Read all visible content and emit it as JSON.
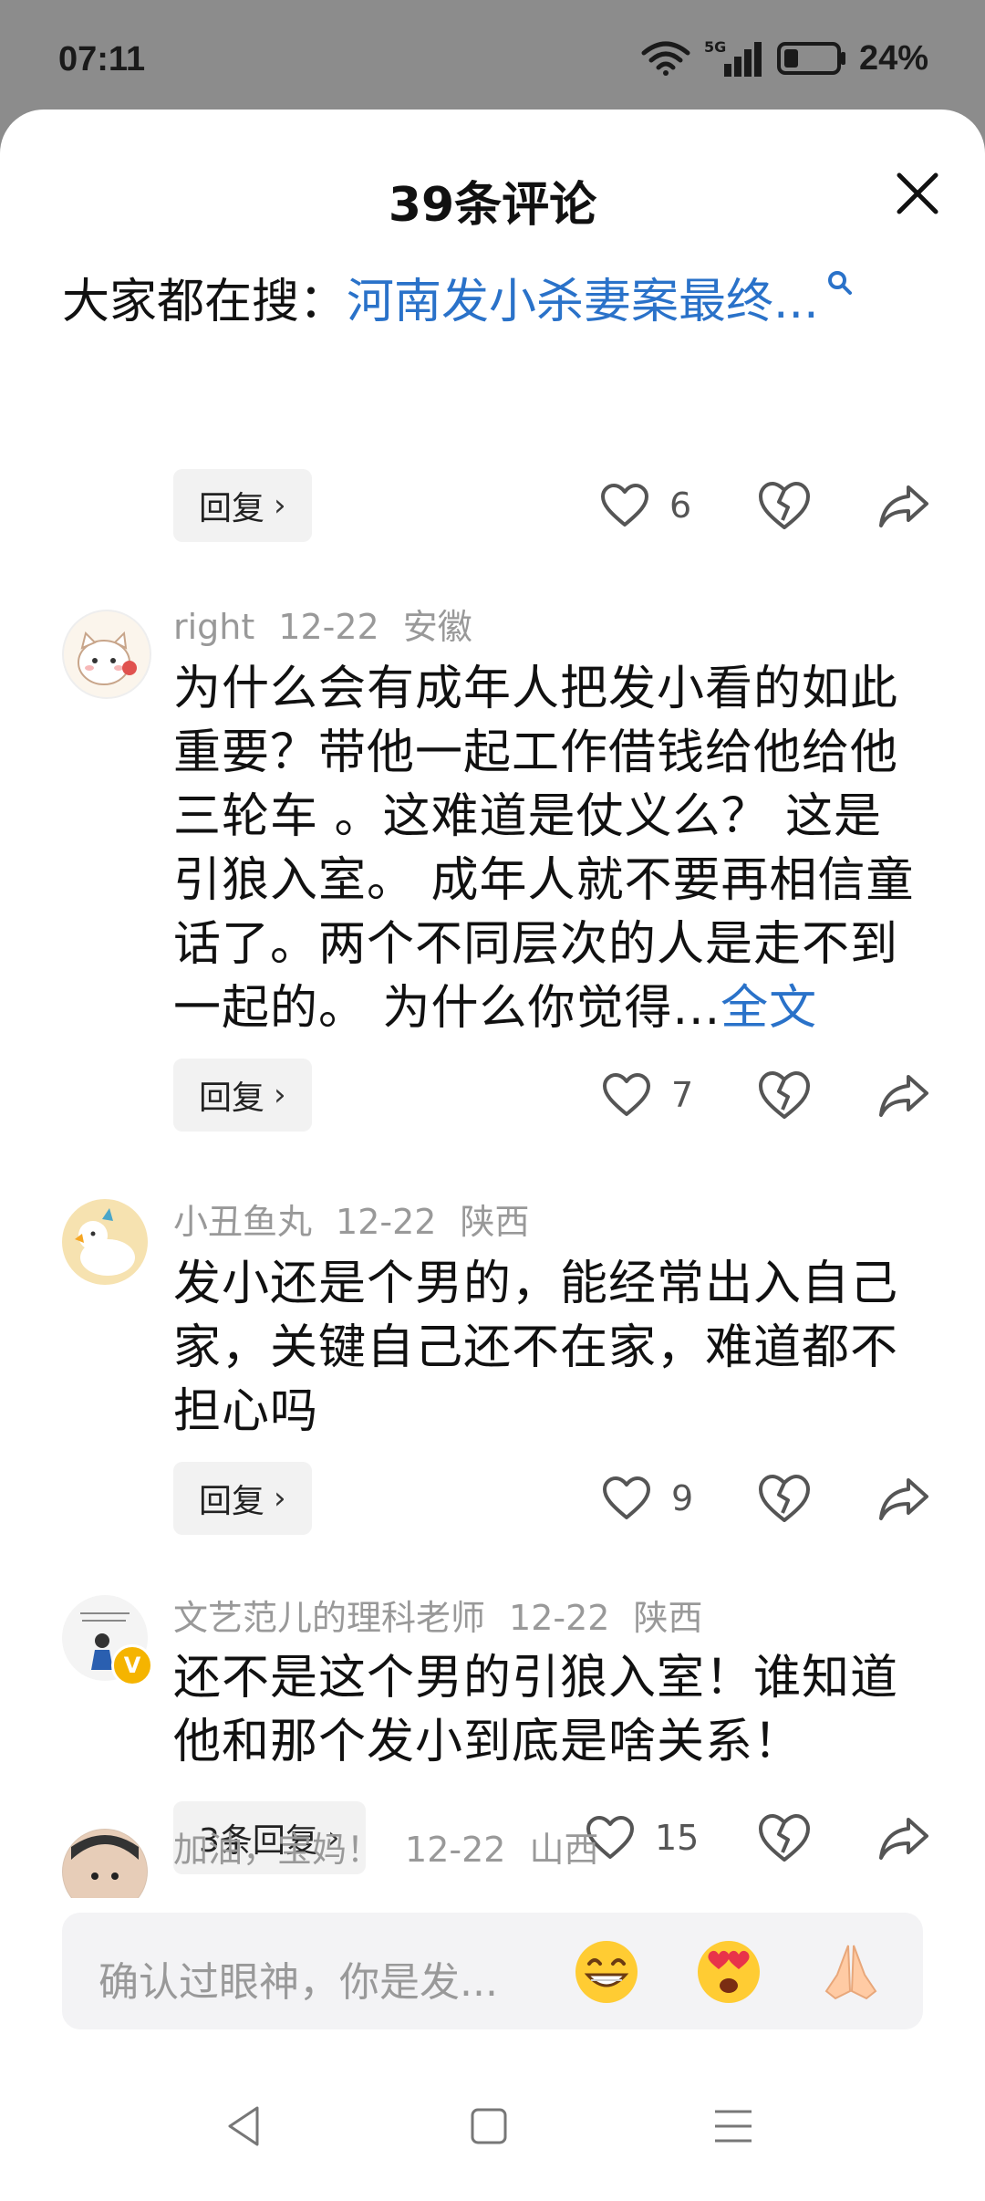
{
  "status": {
    "time": "07:11",
    "network": "5G",
    "battery": "24%"
  },
  "header": {
    "title": "39条评论"
  },
  "suggest": {
    "label": "大家都在搜：",
    "query": "河南发小杀妻案最终..."
  },
  "comments": [
    {
      "reply_label": "回复",
      "likes": "6"
    },
    {
      "user": "right",
      "date": "12-22",
      "location": "安徽",
      "text": "为什么会有成年人把发小看的如此重要？带他一起工作借钱给他给他三轮车 。这难道是仗义么？ 这是引狼入室。 成年人就不要再相信童话了。两个不同层次的人是走不到一起的。 为什么你觉得...",
      "more": "全文",
      "reply_label": "回复",
      "likes": "7"
    },
    {
      "user": "小丑鱼丸",
      "date": "12-22",
      "location": "陕西",
      "text": "发小还是个男的，能经常出入自己家，关键自己还不在家，难道都不担心吗",
      "reply_label": "回复",
      "likes": "9"
    },
    {
      "user": "文艺范儿的理科老师",
      "date": "12-22",
      "location": "陕西",
      "text": "还不是这个男的引狼入室！谁知道他和那个发小到底是啥关系！",
      "reply_label": "3条回复",
      "likes": "15"
    },
    {
      "user": "加油，宝妈！",
      "date": "12-22",
      "location": "山西"
    }
  ],
  "input": {
    "placeholder": "确认过眼神，你是发..."
  },
  "colors": {
    "link": "#2a72c9",
    "meta": "#999999",
    "reply_bg": "#f2f2f2"
  }
}
